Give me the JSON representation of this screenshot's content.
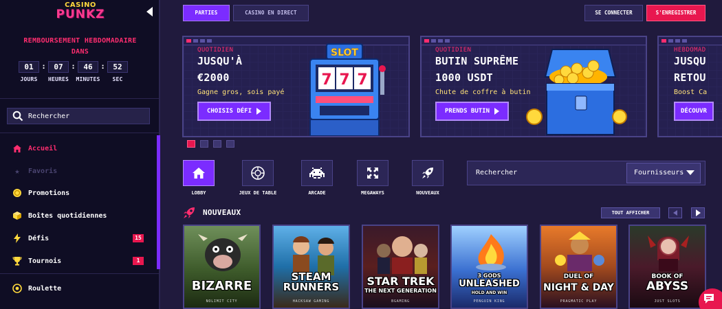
{
  "brand": {
    "line1": "CASINO",
    "line2": "PUNKZ"
  },
  "cashback": {
    "title_line1": "REMBOURSEMENT HEBDOMADAIRE",
    "title_line2": "DANS",
    "days": "01",
    "hours": "07",
    "minutes": "46",
    "seconds": "52",
    "days_label": "JOURS",
    "hours_label": "HEURES",
    "minutes_label": "MINUTES",
    "seconds_label": "SEC"
  },
  "sidebar": {
    "search_label": "Rechercher",
    "items": [
      {
        "label": "Accueil",
        "icon": "home-icon"
      },
      {
        "label": "Favoris",
        "icon": "star-icon"
      },
      {
        "label": "Promotions",
        "icon": "coin-icon"
      },
      {
        "label": "Boîtes quotidiennes",
        "icon": "box-icon"
      },
      {
        "label": "Défis",
        "icon": "lightning-icon",
        "badge": "15"
      },
      {
        "label": "Tournois",
        "icon": "trophy-icon",
        "badge": "1"
      },
      {
        "label": "Roulette",
        "icon": "roulette-icon"
      }
    ]
  },
  "header": {
    "tab_parties": "PARTIES",
    "tab_live": "CASINO EN DIRECT",
    "login": "SE CONNECTER",
    "register": "S'ENREGISTRER"
  },
  "banners": [
    {
      "category": "QUOTIDIEN",
      "headline": "JUSQU'À",
      "amount": "€2000",
      "description": "Gagne gros, sois payé",
      "cta": "CHOISIS DÉFI"
    },
    {
      "category": "QUOTIDIEN",
      "headline": "BUTIN SUPRÊME",
      "amount": "1000 USDT",
      "description": "Chute de coffre à butin",
      "cta": "PRENDS BUTIN"
    },
    {
      "category": "HEBDOMAD",
      "headline": "JUSQU",
      "amount": "RETOU",
      "description": "Boost Ca",
      "cta": "DÉCOUVR"
    }
  ],
  "categories": [
    {
      "label": "LOBBY",
      "icon": "home-icon"
    },
    {
      "label": "JEUX DE TABLE",
      "icon": "chip-icon"
    },
    {
      "label": "ARCADE",
      "icon": "space-invader-icon"
    },
    {
      "label": "MEGAWAYS",
      "icon": "arrows-expand-icon"
    },
    {
      "label": "NOUVEAUX",
      "icon": "rocket-icon"
    }
  ],
  "game_search": {
    "placeholder": "Rechercher",
    "providers_label": "Fournisseurs"
  },
  "new_games": {
    "title": "NOUVEAUX",
    "show_all": "TOUT AFFICHER",
    "games": [
      {
        "title": "BIZARRE",
        "provider": "NOLIMIT CITY",
        "bg": "#3d5a2a"
      },
      {
        "title": "STEAM RUNNERS",
        "provider": "HACKSAW GAMING",
        "bg": "#1f6fa8"
      },
      {
        "title": "STAR TREK",
        "subtitle": "THE NEXT GENERATION",
        "provider": "BGAMING",
        "bg": "#5a1f1f"
      },
      {
        "pretitle": "3 GODS",
        "title": "UNLEASHED",
        "subtitle": "HOLD AND WIN",
        "provider": "PENGUIN KING",
        "bg": "#3a6fd0"
      },
      {
        "pretitle": "DUEL OF",
        "title": "NIGHT & DAY",
        "provider": "PRAGMATIC PLAY",
        "bg": "#a34a1e"
      },
      {
        "pretitle": "BOOK OF",
        "title": "ABYSS",
        "provider": "JUST SLOTS",
        "bg": "#4a1a2a"
      }
    ]
  },
  "colors": {
    "accent": "#7b2cff",
    "brand_pink": "#e8174f",
    "background": "#201a3d",
    "sidebar": "#0f0d24"
  }
}
